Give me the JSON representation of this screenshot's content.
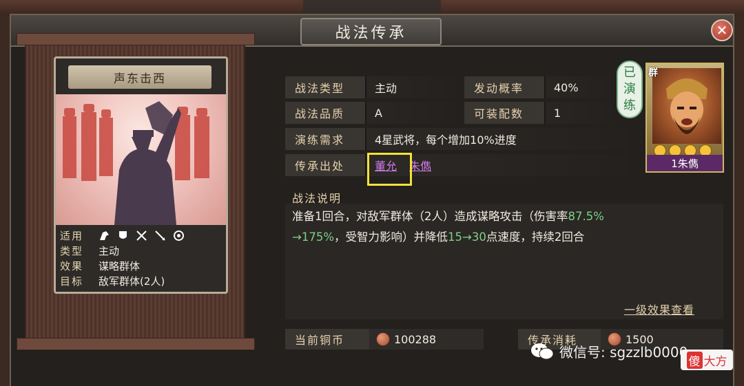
{
  "window": {
    "title": "战法传承"
  },
  "card": {
    "name": "声东击西",
    "suitable_label": "适用",
    "suitable_icons": [
      "cavalry-icon",
      "shield-icon",
      "bow-icon",
      "spear-icon",
      "machine-icon"
    ],
    "rows": [
      {
        "key": "类型",
        "value": "主动"
      },
      {
        "key": "效果",
        "value": "谋略群体"
      },
      {
        "key": "目标",
        "value": "敌军群体(2人)"
      }
    ]
  },
  "info": {
    "type_label": "战法类型",
    "type_value": "主动",
    "prob_label": "发动概率",
    "prob_value": "40%",
    "quality_label": "战法品质",
    "quality_value": "A",
    "equip_label": "可装配数",
    "equip_value": "1",
    "req_label": "演练需求",
    "req_value": "4星武将，每个增加10%进度",
    "source_label": "传承出处",
    "source_1": "董允",
    "source_2": "朱儁"
  },
  "description": {
    "title": "战法说明",
    "seg1": "准备1回合，对敌军群体（2人）造成谋略攻击（伤害率",
    "seg2": "87.5%",
    "seg3": "→175%",
    "seg4": "，受智力影响）并降低",
    "seg5": "15→30",
    "seg6": "点速度，持续2回合",
    "view_link": "一级效果查看"
  },
  "resources": {
    "copper_label": "当前铜币",
    "copper_value": "100288",
    "cost_label": "传承消耗",
    "cost_value": "1500"
  },
  "general": {
    "faction": "群",
    "stars": 4,
    "name": "1朱儁",
    "stamp_chars": [
      "已",
      "演",
      "练"
    ]
  },
  "watermark": {
    "text": "微信号: sgzzlb0000",
    "badge_char": "傻",
    "badge_rest": "大方"
  },
  "colors": {
    "accent_green": "#7ed187",
    "link_purple": "#d17be6",
    "highlight": "#f4e23b"
  }
}
